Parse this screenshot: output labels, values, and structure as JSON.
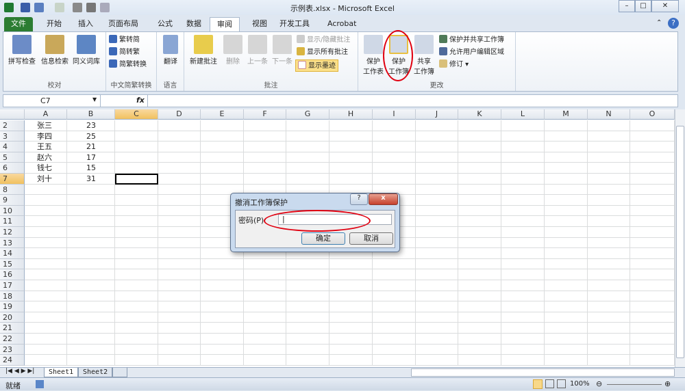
{
  "window": {
    "title": "示例表.xlsx - Microsoft Excel",
    "minimize": "–",
    "maximize": "□",
    "close": "✕"
  },
  "tabs": [
    "文件",
    "开始",
    "插入",
    "页面布局",
    "公式",
    "数据",
    "审阅",
    "视图",
    "开发工具",
    "Acrobat"
  ],
  "active_tab": "审阅",
  "ribbon": {
    "proofing": {
      "label": "校对",
      "buttons": [
        "拼写检查",
        "信息检索",
        "同义词库"
      ]
    },
    "chinese": {
      "label": "中文简繁转换",
      "buttons": [
        "繁转简",
        "简转繁",
        "简繁转换"
      ]
    },
    "language": {
      "label": "语言",
      "buttons": [
        "翻译"
      ]
    },
    "comments": {
      "label": "批注",
      "buttons": [
        "新建批注",
        "删除",
        "上一条",
        "下一条"
      ],
      "small": [
        "显示/隐藏批注",
        "显示所有批注",
        "显示墨迹"
      ]
    },
    "changes": {
      "label": "更改",
      "protect_sheet": [
        "保护",
        "工作表"
      ],
      "protect_book": [
        "保护",
        "工作簿"
      ],
      "share_book": [
        "共享",
        "工作簿"
      ],
      "small": [
        "保护并共享工作簿",
        "允许用户编辑区域",
        "修订 ▾"
      ]
    }
  },
  "formula_bar": {
    "name_box": "C7",
    "fx": "fx",
    "value": ""
  },
  "columns": [
    "A",
    "B",
    "C",
    "D",
    "E",
    "F",
    "G",
    "H",
    "I",
    "J",
    "K",
    "L",
    "M",
    "N",
    "O"
  ],
  "selected_cell": "C7",
  "rows": [
    {
      "n": "2",
      "a": "张三",
      "b": "23"
    },
    {
      "n": "3",
      "a": "李四",
      "b": "25"
    },
    {
      "n": "4",
      "a": "王五",
      "b": "21"
    },
    {
      "n": "5",
      "a": "赵六",
      "b": "17"
    },
    {
      "n": "6",
      "a": "钱七",
      "b": "15"
    },
    {
      "n": "7",
      "a": "刘十",
      "b": "31"
    },
    {
      "n": "8"
    },
    {
      "n": "9"
    },
    {
      "n": "10"
    },
    {
      "n": "11"
    },
    {
      "n": "12"
    },
    {
      "n": "13"
    },
    {
      "n": "14"
    },
    {
      "n": "15"
    },
    {
      "n": "16"
    },
    {
      "n": "17"
    },
    {
      "n": "18"
    },
    {
      "n": "19"
    },
    {
      "n": "20"
    },
    {
      "n": "21"
    },
    {
      "n": "22"
    },
    {
      "n": "23"
    },
    {
      "n": "24"
    }
  ],
  "sheets": [
    "Sheet1",
    "Sheet2"
  ],
  "active_sheet": "Sheet1",
  "status": {
    "ready": "就绪",
    "zoom": "100%"
  },
  "dialog": {
    "title": "撤消工作簿保护",
    "help": "?",
    "close": "x",
    "password_label": "密码(P):",
    "password_value": "",
    "ok": "确定",
    "cancel": "取消"
  },
  "colors": {
    "file_tab": "#2c7d32",
    "highlight_ellipse": "#e00010",
    "selection_header": "#f1c15f"
  }
}
